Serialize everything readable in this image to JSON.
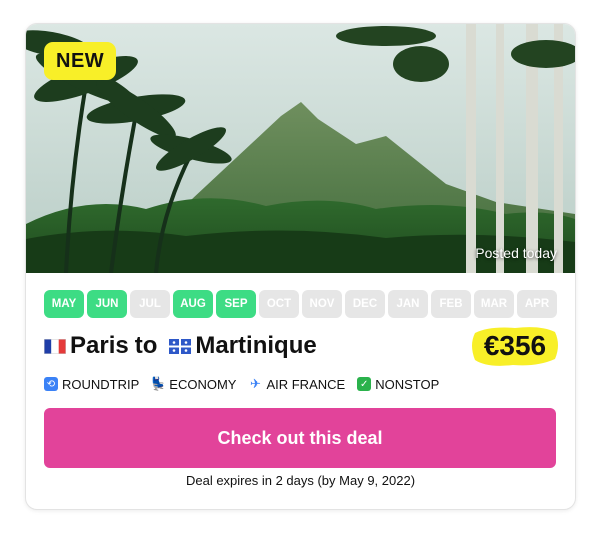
{
  "badge": {
    "label": "NEW"
  },
  "hero": {
    "posted": "Posted today"
  },
  "months": [
    {
      "label": "MAY",
      "available": true
    },
    {
      "label": "JUN",
      "available": true
    },
    {
      "label": "JUL",
      "available": false
    },
    {
      "label": "AUG",
      "available": true
    },
    {
      "label": "SEP",
      "available": true
    },
    {
      "label": "OCT",
      "available": false
    },
    {
      "label": "NOV",
      "available": false
    },
    {
      "label": "DEC",
      "available": false
    },
    {
      "label": "JAN",
      "available": false
    },
    {
      "label": "FEB",
      "available": false
    },
    {
      "label": "MAR",
      "available": false
    },
    {
      "label": "APR",
      "available": false
    }
  ],
  "route": {
    "from": "Paris",
    "connector": "to",
    "to": "Martinique"
  },
  "price": "€356",
  "tags": {
    "trip": "ROUNDTRIP",
    "cabin": "ECONOMY",
    "airline": "AIR FRANCE",
    "stops": "NONSTOP"
  },
  "cta": {
    "label": "Check out this deal"
  },
  "expires": "Deal expires in 2 days (by May 9, 2022)",
  "colors": {
    "accent": "#e2439a",
    "month_on": "#3ddc84",
    "month_off": "#e6e6e6",
    "highlight": "#f8ef28"
  },
  "icons": {
    "from_flag": "france-flag-icon",
    "to_flag": "martinique-flag-icon",
    "trip": "roundtrip-icon",
    "cabin": "seat-icon",
    "airline": "airplane-icon",
    "stops": "check-icon"
  }
}
